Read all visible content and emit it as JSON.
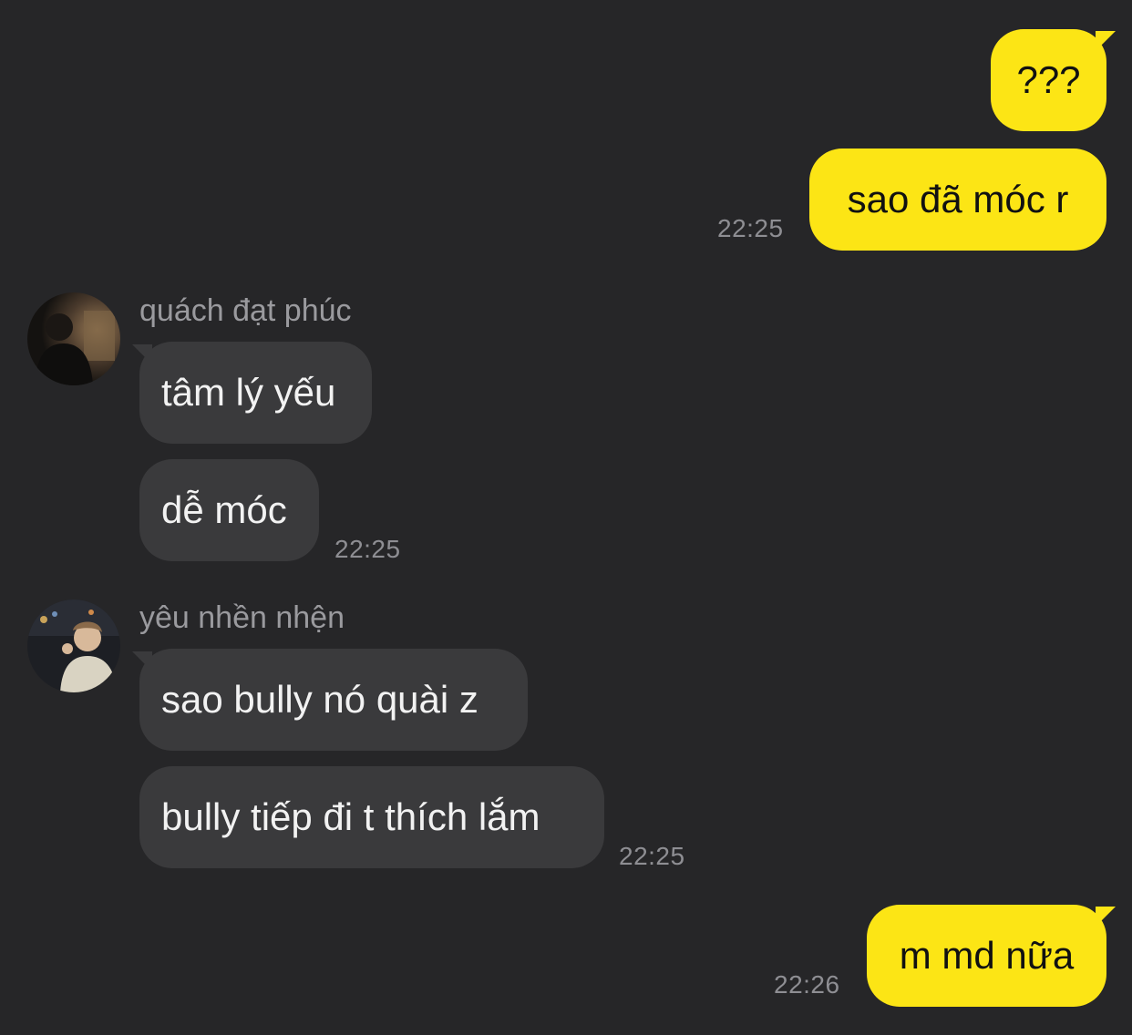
{
  "messages": {
    "out_1": {
      "text": "???"
    },
    "out_2": {
      "text": "sao đã móc r",
      "time": "22:25"
    },
    "group_1": {
      "sender": "quách đạt phúc",
      "msg_1": "tâm lý yếu",
      "msg_2": "dễ móc",
      "time": "22:25"
    },
    "group_2": {
      "sender": "yêu nhền nhện",
      "msg_1": "sao bully nó quài z",
      "msg_2": "bully tiếp đi t thích lắm",
      "time": "22:25"
    },
    "out_3": {
      "text": "m md nữa",
      "time": "22:26"
    }
  },
  "colors": {
    "background": "#262628",
    "outgoing_bubble": "#fce515",
    "incoming_bubble": "#3a3a3c",
    "timestamp": "#8e8e93"
  }
}
